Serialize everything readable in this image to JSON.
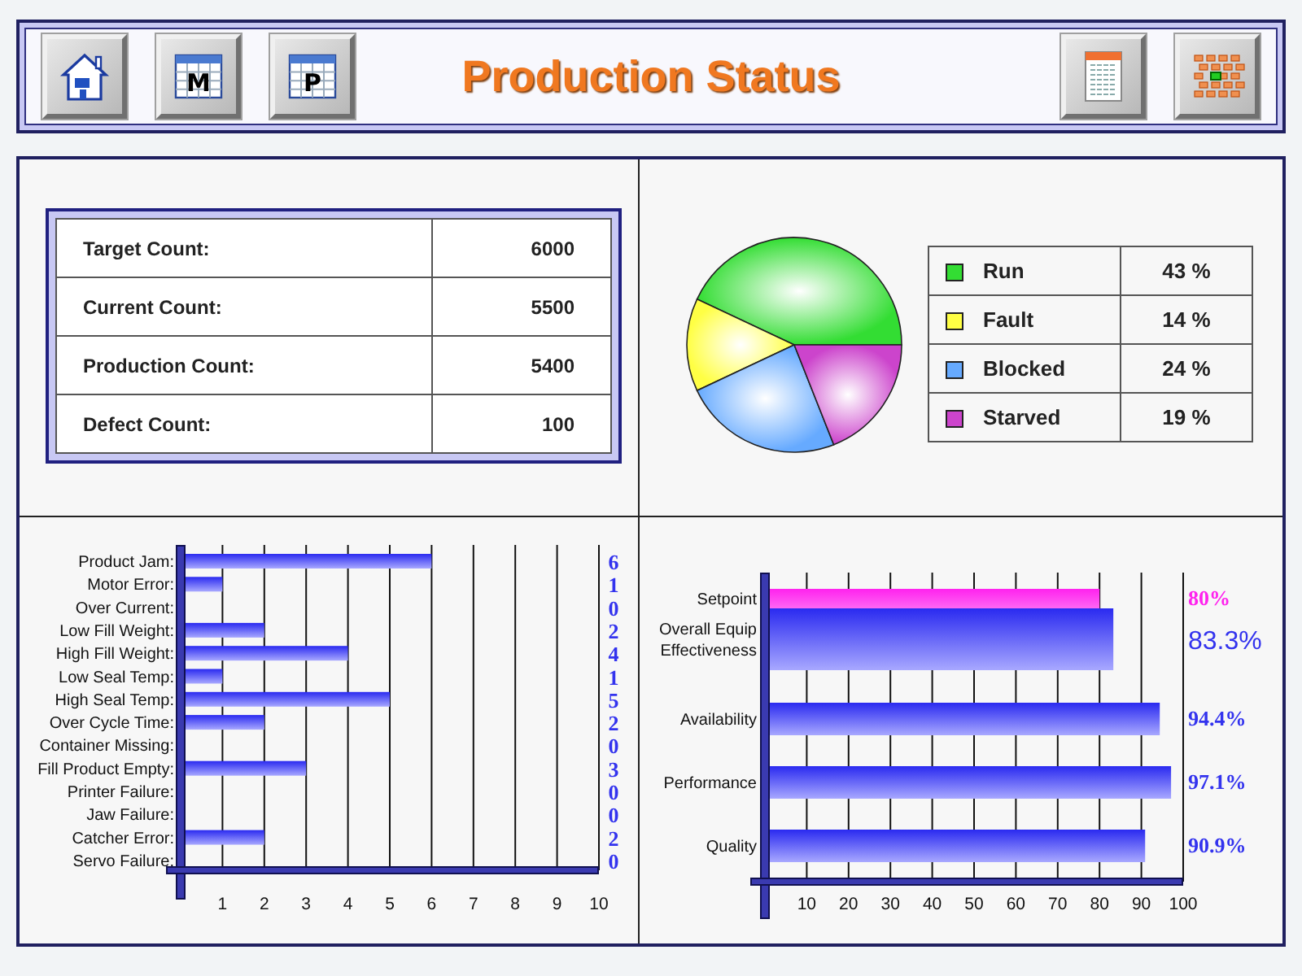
{
  "header": {
    "title": "Production Status",
    "left_buttons": [
      {
        "kind": "home"
      },
      {
        "kind": "table",
        "letter": "M"
      },
      {
        "kind": "table",
        "letter": "P"
      }
    ],
    "right_buttons": [
      {
        "kind": "report"
      },
      {
        "kind": "diagram"
      }
    ]
  },
  "counts": [
    {
      "label": "Target Count:",
      "value": "6000"
    },
    {
      "label": "Current Count:",
      "value": "5500"
    },
    {
      "label": "Production Count:",
      "value": "5400"
    },
    {
      "label": "Defect Count:",
      "value": "100"
    }
  ],
  "status": {
    "chart_data": {
      "type": "pie",
      "categories": [
        "Run",
        "Fault",
        "Blocked",
        "Starved"
      ],
      "values": [
        43,
        14,
        24,
        19
      ]
    },
    "legend": [
      {
        "value": "43 %",
        "color": "#33dd33"
      },
      {
        "value": "14 %",
        "color": "#ffff44"
      },
      {
        "value": "24 %",
        "color": "#66aaff"
      },
      {
        "value": "19 %",
        "color": "#cc44cc"
      }
    ]
  },
  "faults": {
    "label_separator": ":",
    "chart_data": {
      "type": "bar",
      "orientation": "horizontal",
      "categories": [
        "Product Jam",
        "Motor Error",
        "Over Current",
        "Low Fill Weight",
        "High Fill Weight",
        "Low Seal Temp",
        "High Seal Temp",
        "Over Cycle Time",
        "Container Missing",
        "Fill Product Empty",
        "Printer Failure",
        "Jaw Failure",
        "Catcher Error",
        "Servo Failure"
      ],
      "grid": true,
      "series": [
        {
          "color": "#3333ee",
          "values": [
            6,
            1,
            0,
            2,
            4,
            1,
            5,
            2,
            0,
            3,
            0,
            0,
            2,
            0
          ]
        }
      ],
      "xlim": [
        0,
        10
      ],
      "xticks": [
        1,
        2,
        3,
        4,
        5,
        6,
        7,
        8,
        9,
        10
      ],
      "data_labels": true
    }
  },
  "oee": {
    "chart_data": {
      "type": "bar",
      "orientation": "horizontal",
      "categories": [
        "Setpoint",
        "Overall Equip Effectiveness",
        "Availability",
        "Performance",
        "Quality"
      ],
      "series": [
        {
          "color": "#ff22ee",
          "values": [
            80,
            null,
            null,
            null,
            null
          ]
        },
        {
          "color": "#3333ee",
          "values": [
            null,
            83.3,
            94.4,
            97.1,
            90.9
          ]
        }
      ],
      "xlim": [
        0,
        100
      ],
      "grid": true,
      "xticks": [
        10,
        20,
        30,
        40,
        50,
        60,
        70,
        80,
        90,
        100
      ],
      "value_labels": [
        "80%",
        "83.3%",
        "94.4%",
        "97.1%",
        "90.9%"
      ]
    }
  }
}
